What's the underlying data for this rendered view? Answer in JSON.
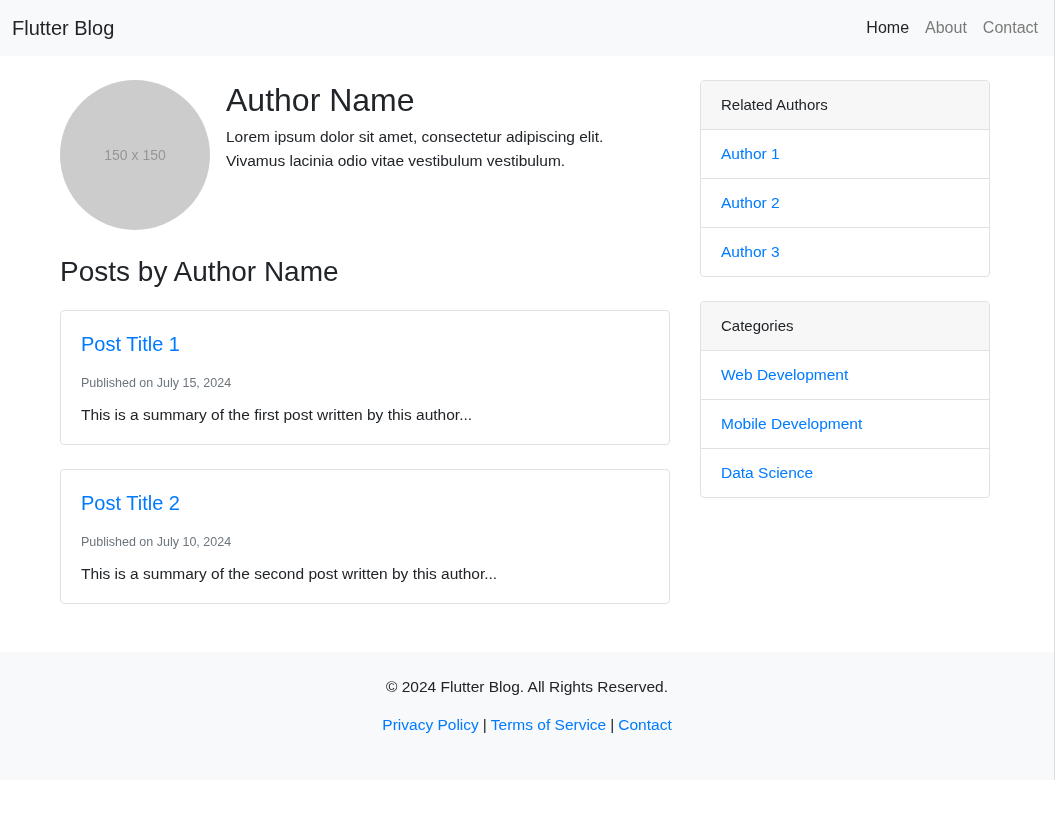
{
  "navbar": {
    "brand": "Flutter Blog",
    "links": [
      {
        "label": "Home",
        "selected": true
      },
      {
        "label": "About",
        "selected": false
      },
      {
        "label": "Contact",
        "selected": false
      }
    ]
  },
  "author": {
    "avatar_text": "150 x 150",
    "name": "Author Name",
    "bio": "Lorem ipsum dolor sit amet, consectetur adipiscing elit. Vivamus lacinia odio vitae vestibulum vestibulum."
  },
  "posts_heading": "Posts by Author Name",
  "posts": [
    {
      "title": "Post Title 1",
      "date": "Published on July 15, 2024",
      "summary": "This is a summary of the first post written by this author..."
    },
    {
      "title": "Post Title 2",
      "date": "Published on July 10, 2024",
      "summary": "This is a summary of the second post written by this author..."
    }
  ],
  "sidebar": [
    {
      "title": "Related Authors",
      "items": [
        "Author 1",
        "Author 2",
        "Author 3"
      ]
    },
    {
      "title": "Categories",
      "items": [
        "Web Development",
        "Mobile Development",
        "Data Science"
      ]
    }
  ],
  "footer": {
    "copyright": "© 2024 Flutter Blog. All Rights Reserved.",
    "links": [
      "Privacy Policy",
      "Terms of Service",
      "Contact"
    ],
    "separator": "|"
  }
}
